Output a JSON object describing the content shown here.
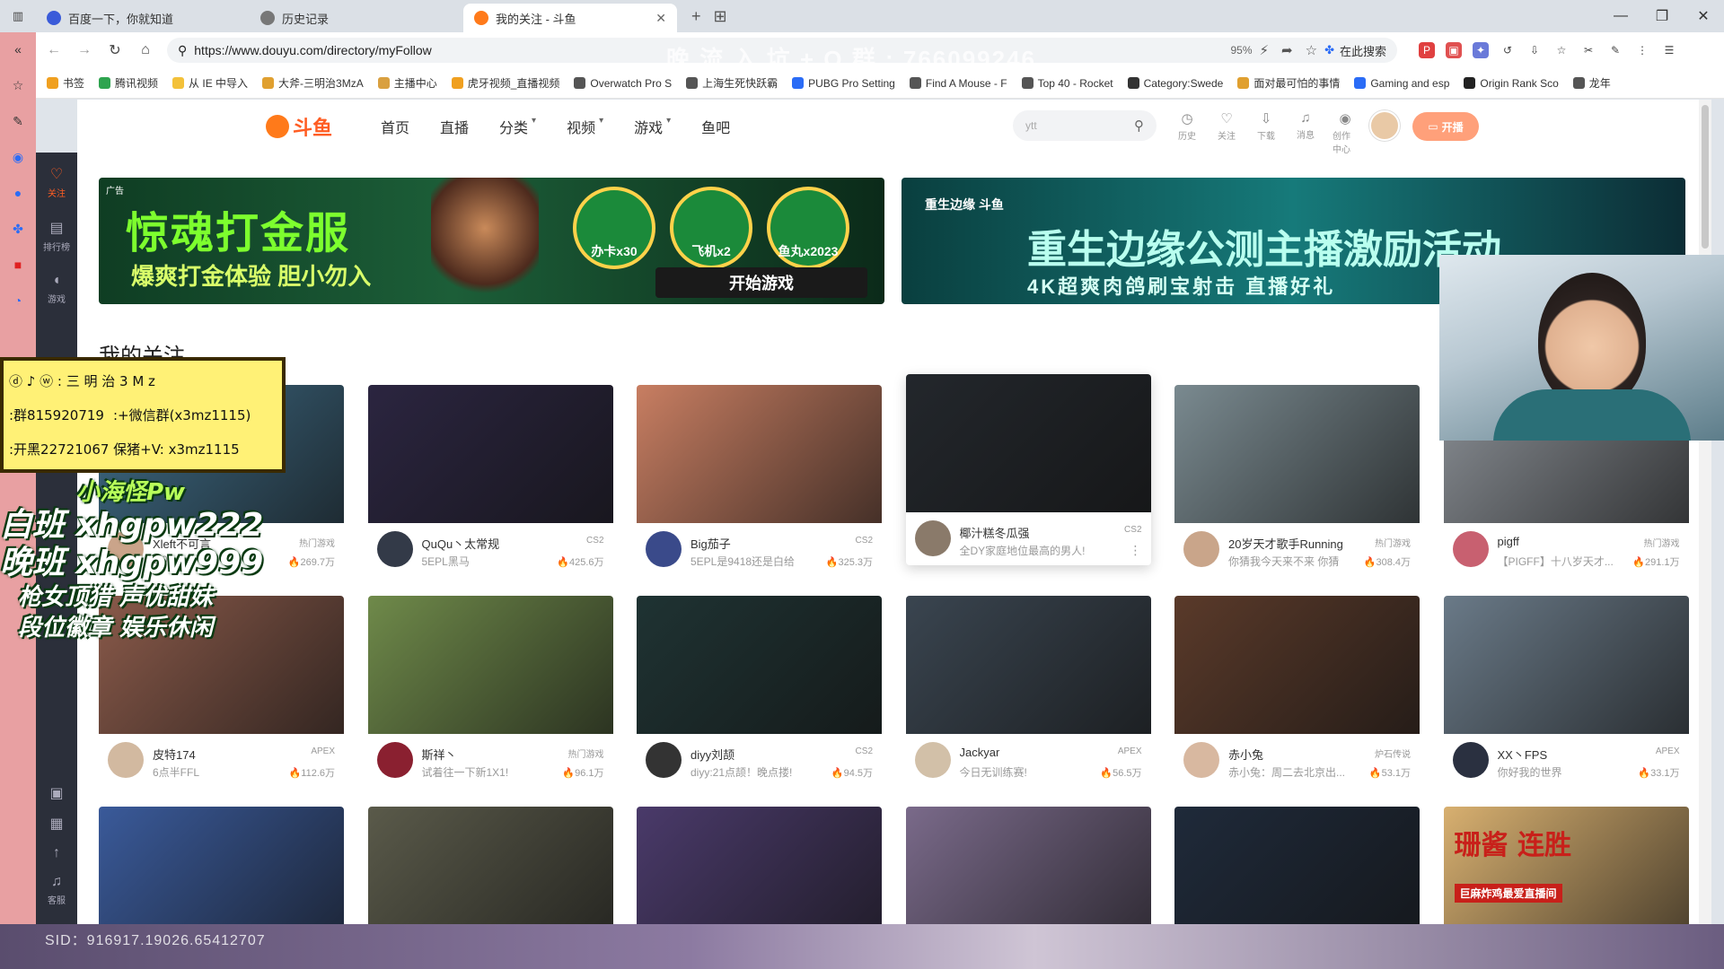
{
  "tabs": [
    {
      "label": "百度一下，你就知道",
      "icon_color": "#3a5bd9",
      "active": false
    },
    {
      "label": "历史记录",
      "icon_color": "#777777",
      "active": false
    },
    {
      "label": "我的关注 - 斗鱼",
      "icon_color": "#ff7a1a",
      "active": true
    }
  ],
  "address": {
    "url": "https://www.douyu.com/directory/myFollow",
    "zoom": "95%",
    "search_label": "在此搜索"
  },
  "watermark": "晚 流 入 坑 + Q 群 : 766099246",
  "bookmarks": [
    {
      "label": "书签",
      "color": "#f0a020"
    },
    {
      "label": "腾讯视频",
      "color": "#2ea44f"
    },
    {
      "label": "从 IE 中导入",
      "color": "#f3c13a"
    },
    {
      "label": "大斧-三明治3MzA",
      "color": "#e0a030"
    },
    {
      "label": "主播中心",
      "color": "#d9a040"
    },
    {
      "label": "虎牙视频_直播视频",
      "color": "#f0a020"
    },
    {
      "label": "Overwatch Pro S",
      "color": "#555555"
    },
    {
      "label": "上海生死快跃霸",
      "color": "#555555"
    },
    {
      "label": "PUBG Pro Setting",
      "color": "#2b6cf6"
    },
    {
      "label": "Find A Mouse - F",
      "color": "#555555"
    },
    {
      "label": "Top 40 - Rocket",
      "color": "#555555"
    },
    {
      "label": "Category:Swede",
      "color": "#333333"
    },
    {
      "label": "面对最可怕的事情",
      "color": "#e0a030"
    },
    {
      "label": "Gaming and esp",
      "color": "#2b6cf6"
    },
    {
      "label": "Origin Rank Sco",
      "color": "#222222"
    },
    {
      "label": "龙年",
      "color": "#555555"
    }
  ],
  "douyu": {
    "logo": "斗鱼",
    "menu": [
      "首页",
      "直播",
      "分类",
      "视频",
      "游戏",
      "鱼吧"
    ],
    "search_placeholder": "ytt",
    "tools": [
      "历史",
      "关注",
      "下载",
      "消息",
      "创作中心"
    ],
    "live_button": "开播",
    "left_nav": [
      {
        "label": "关注",
        "active": true
      },
      {
        "label": "排行榜",
        "active": false
      },
      {
        "label": "游戏",
        "active": false
      }
    ],
    "left_nav_bottom": "客服"
  },
  "banners": {
    "ad_tag": "广告",
    "b1_title": "惊魂打金服",
    "b1_sub": "爆爽打金体验  胆小勿入",
    "b1_badges": [
      "办卡x30",
      "飞机x2",
      "鱼丸x2023"
    ],
    "b1_cta": "开始游戏",
    "b2_brand": "重生边缘 斗鱼",
    "b2_title": "重生边缘公测主播激励活动",
    "b2_sub": "4K超爽肉鸽刷宝射击  直播好礼"
  },
  "section_title": "我的关注",
  "cards": [
    {
      "name": "Xleft不可言",
      "category": "热门游戏",
      "title": "5.0",
      "heat": "269.7万",
      "thumb": "#3f6d88",
      "avatar": "#caa48a"
    },
    {
      "name": "QuQu丶太常规",
      "category": "CS2",
      "title": "5EPL黑马",
      "heat": "425.6万",
      "thumb": "#2b2540",
      "avatar": "#333a48"
    },
    {
      "name": "Big茄子",
      "category": "CS2",
      "title": "5EPL是9418还是白给",
      "heat": "325.3万",
      "thumb": "#c87e62",
      "avatar": "#3a4a8a"
    },
    {
      "name": "椰汁糕冬瓜强",
      "category": "CS2",
      "title": "全DY家庭地位最高的男人!",
      "heat": "",
      "thumb": "#23272c",
      "avatar": "#8a7a6a",
      "raised": true
    },
    {
      "name": "20岁天才歌手Running",
      "category": "热门游戏",
      "title": "你猜我今天来不来 你猜",
      "heat": "308.4万",
      "thumb": "#7a8a90",
      "avatar": "#c9a58a"
    },
    {
      "name": "pigff",
      "category": "热门游戏",
      "title": "【PIGFF】十八岁天才...",
      "heat": "291.1万",
      "thumb": "#8a8f95",
      "avatar": "#c86070"
    },
    {
      "name": "皮特174",
      "category": "APEX",
      "title": "6点半FFL",
      "heat": "112.6万",
      "thumb": "#8a5a4a",
      "avatar": "#d2b9a0"
    },
    {
      "name": "斯祥丶",
      "category": "热门游戏",
      "title": "试着往一下新1X1!",
      "heat": "96.1万",
      "thumb": "#6f8a4a",
      "avatar": "#8a2030"
    },
    {
      "name": "diyy刘颉",
      "category": "CS2",
      "title": "diyy:21点颉！晚点搂!",
      "heat": "94.5万",
      "thumb": "#1f3333",
      "avatar": "#333333"
    },
    {
      "name": "Jackyar",
      "category": "APEX",
      "title": "今日无训练赛!",
      "heat": "56.5万",
      "thumb": "#3a4550",
      "avatar": "#d2c0a8"
    },
    {
      "name": "赤小兔",
      "category": "炉石传说",
      "title": "赤小兔：周二去北京出...",
      "heat": "53.1万",
      "thumb": "#5a3a2a",
      "avatar": "#d8b8a0"
    },
    {
      "name": "XX丶FPS",
      "category": "APEX",
      "title": "你好我的世界",
      "heat": "33.1万",
      "thumb": "#6a7a88",
      "avatar": "#2a3040"
    },
    {
      "name": "",
      "category": "",
      "title": "",
      "heat": "",
      "thumb": "#3a5a9a",
      "avatar": ""
    },
    {
      "name": "",
      "category": "",
      "title": "",
      "heat": "",
      "thumb": "#5a5a4a",
      "avatar": ""
    },
    {
      "name": "",
      "category": "",
      "title": "",
      "heat": "",
      "thumb": "#4a3a6a",
      "avatar": ""
    },
    {
      "name": "",
      "category": "",
      "title": "",
      "heat": "",
      "thumb": "#7a6a8a",
      "avatar": ""
    },
    {
      "name": "",
      "category": "",
      "title": "",
      "heat": "",
      "thumb": "#1f2a3a",
      "avatar": ""
    },
    {
      "name": "",
      "category": "",
      "title": "",
      "heat": "",
      "thumb": "#d8b070",
      "avatar": "",
      "promo_title": "珊酱 连胜",
      "promo_sub": "巨麻炸鸡最爱直播间"
    }
  ],
  "overlay": {
    "line1": "ⓓ ♪ ⓦ : 三 明 治 3 M z",
    "line2a": ":群815920719",
    "line2b": ":+微信群(x3mz1115)",
    "line3": ":开黑22721067  保猪+V: x3mz1115",
    "promo_wx": "小海怪Pw",
    "promo_day": "白班  xhgpw222",
    "promo_night": "晚班  xhgpw999",
    "promo_tag1": "枪女顶猎  声优甜妹",
    "promo_tag2": "段位徽章  娱乐休闲"
  },
  "sid": "SID：916917.19026.65412707"
}
